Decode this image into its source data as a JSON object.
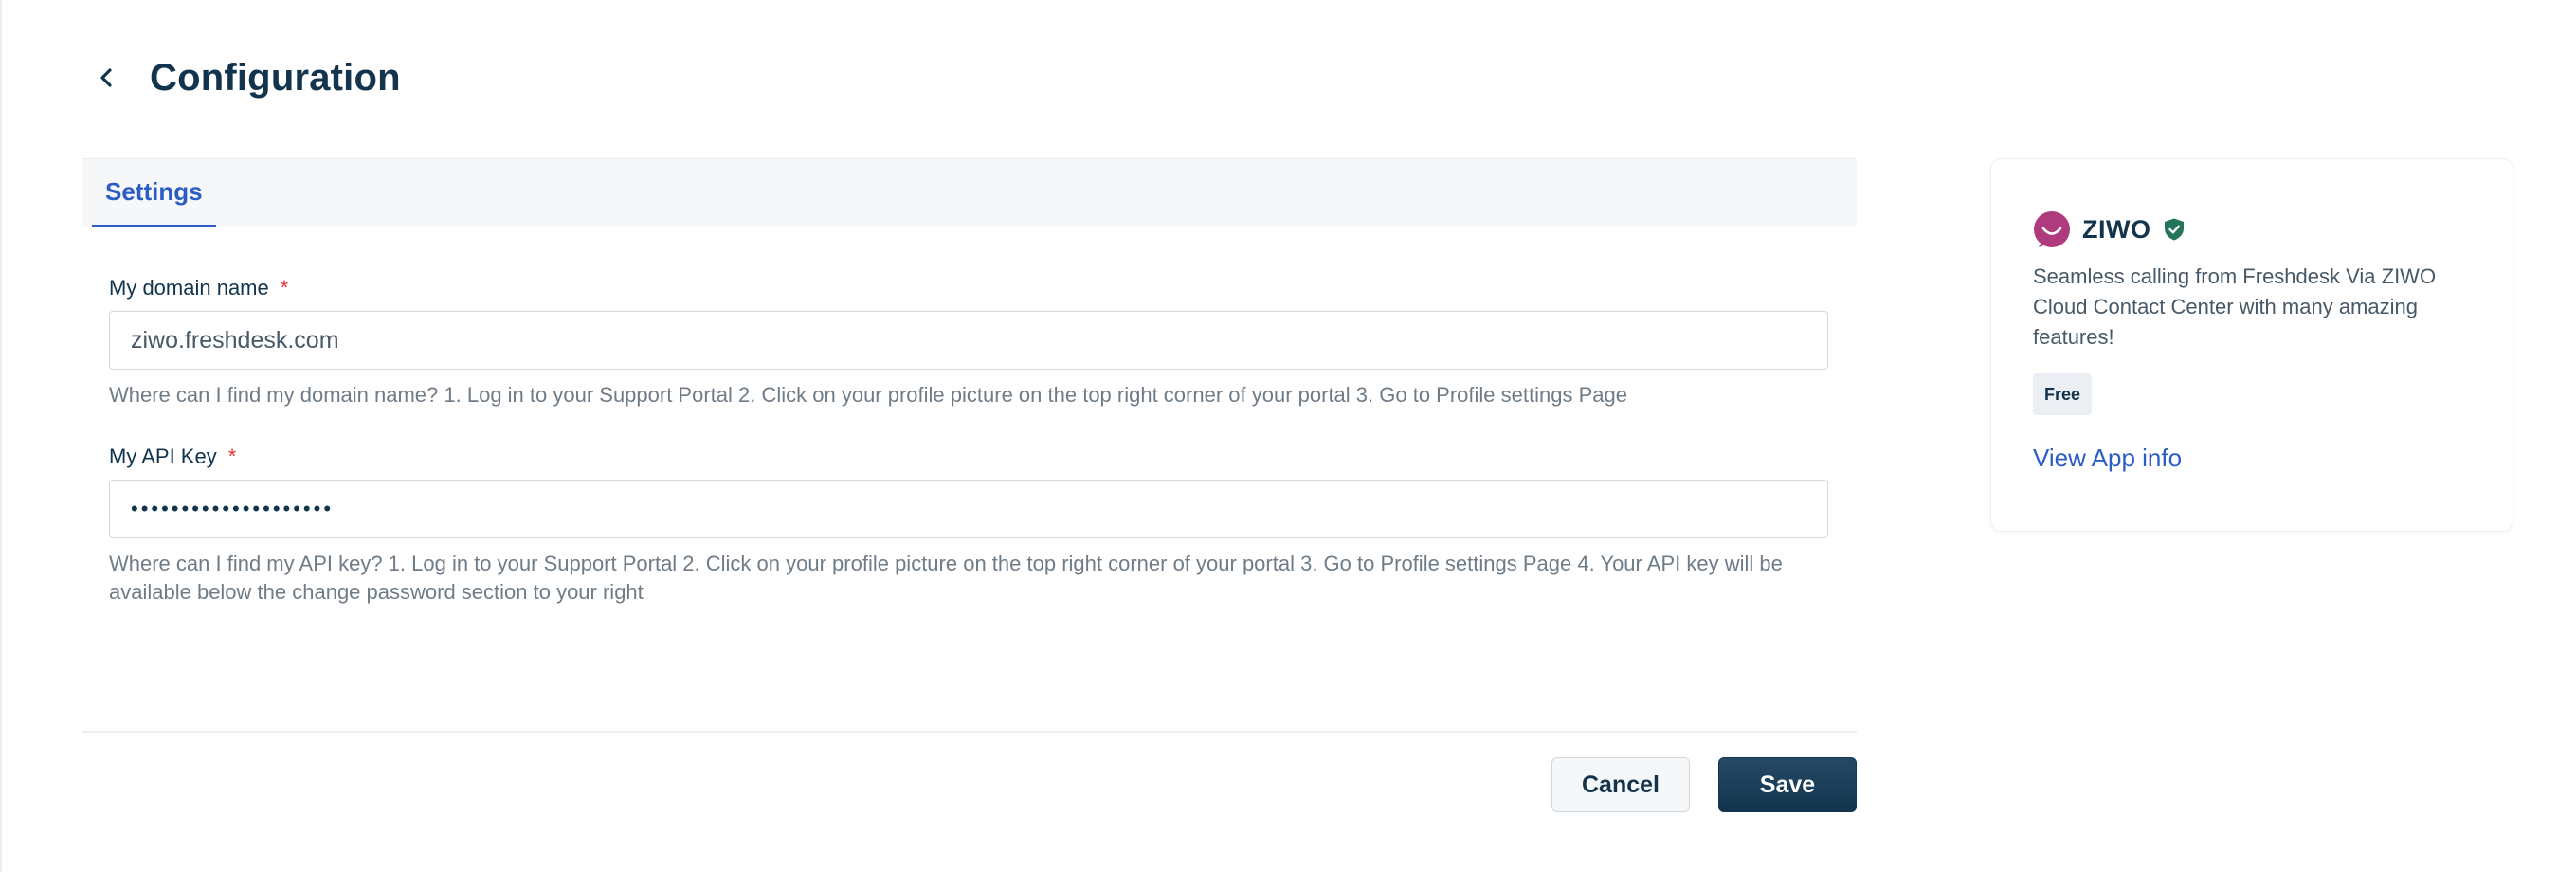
{
  "header": {
    "title": "Configuration",
    "back_icon": "chevron-left-icon"
  },
  "tabs": [
    {
      "label": "Settings",
      "active": true
    }
  ],
  "form": {
    "domain": {
      "label": "My domain name",
      "required_mark": "*",
      "value": "ziwo.freshdesk.com",
      "hint": "Where can I find my domain name? 1. Log in to your Support Portal 2. Click on your profile picture on the top right corner of your portal 3. Go to Profile settings Page"
    },
    "api_key": {
      "label": "My API Key",
      "required_mark": "*",
      "value": "••••••••••••••••••••",
      "hint": "Where can I find my API key? 1. Log in to your Support Portal 2. Click on your profile picture on the top right corner of your portal 3. Go to Profile settings Page 4. Your API key will be available below the change password section to your right"
    }
  },
  "actions": {
    "cancel_label": "Cancel",
    "save_label": "Save"
  },
  "app_card": {
    "name": "ZIWO",
    "logo_icon": "ziwo-logo-icon",
    "verified_icon": "verified-shield-icon",
    "description": "Seamless calling from Freshdesk Via ZIWO Cloud Contact Center with many amazing features!",
    "price": "Free",
    "link_label": "View App info"
  },
  "colors": {
    "title": "#12344d",
    "accent": "#2c5cc5",
    "required": "#e43538",
    "save_button": "#12344d",
    "logo": "#b03a7e",
    "verified": "#24735c"
  }
}
